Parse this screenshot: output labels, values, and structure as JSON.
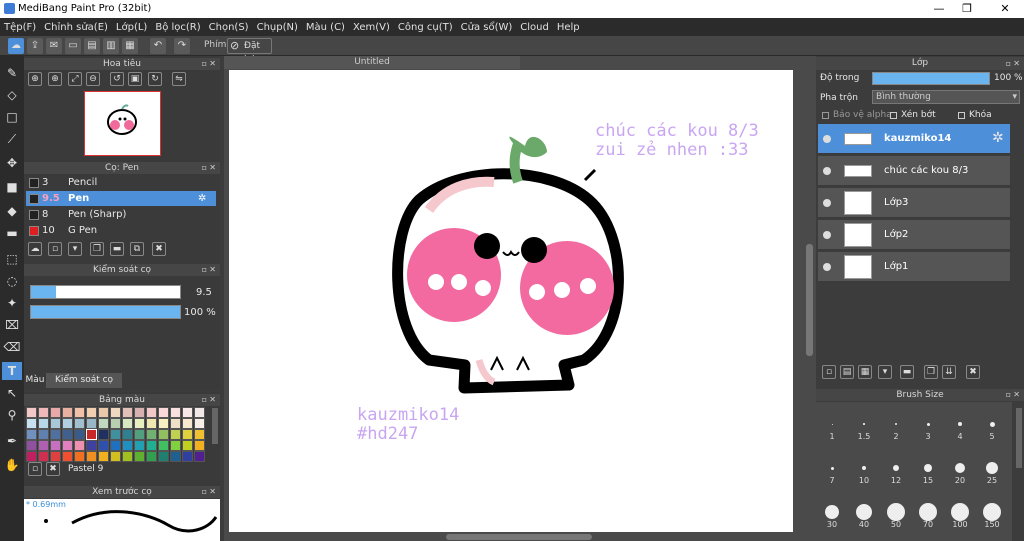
{
  "window": {
    "title": "MediBang Paint Pro (32bit)"
  },
  "menu": [
    "Tệp(F)",
    "Chỉnh sửa(E)",
    "Lớp(L)",
    "Bộ lọc(R)",
    "Chọn(S)",
    "Chụp(N)",
    "Màu (C)",
    "Xem(V)",
    "Công cụ(T)",
    "Cửa sổ(W)",
    "Cloud",
    "Help"
  ],
  "toolbar": {
    "shortcut_label": "Phím",
    "reset_label": "Đặt lại"
  },
  "navigator": {
    "title": "Hoa tiêu"
  },
  "brush_panel": {
    "title": "Cọ: Pen",
    "items": [
      {
        "size": "3",
        "name": "Pencil",
        "color": "#222222"
      },
      {
        "size": "9.5",
        "name": "Pen",
        "color": "#222222"
      },
      {
        "size": "8",
        "name": "Pen (Sharp)",
        "color": "#222222"
      },
      {
        "size": "10",
        "name": "G Pen",
        "color": "#e02020"
      }
    ]
  },
  "brush_control": {
    "title": "Kiểm soát cọ",
    "size_value": "9.5",
    "opacity_value": "100 %",
    "size_fraction": 0.17,
    "opacity_fraction": 1.0,
    "tabs": [
      "Màu",
      "Kiểm soát cọ"
    ]
  },
  "color_palette": {
    "title": "Bảng màu",
    "name": "Pastel 9"
  },
  "preview": {
    "title": "Xem trước cọ",
    "size": "* 0.69mm"
  },
  "canvas": {
    "tab_title": "Untitled",
    "text1": "chúc các kou 8/3",
    "text2": "zui zẻ nhen :33",
    "sign1": "kauzmiko14",
    "sign2": "#hd247",
    "text_color": "#c9a6f2"
  },
  "layers": {
    "title": "Lớp",
    "opacity_label": "Độ trong",
    "opacity_value": "100 %",
    "blend_label": "Pha trộn",
    "blend_value": "Bình thường",
    "alpha_label": "Bảo vệ alpha",
    "clip_label": "Xén bớt",
    "lock_label": "Khóa",
    "items": [
      {
        "name": "kauzmiko14",
        "selected": true
      },
      {
        "name": "chúc các kou 8/3",
        "selected": false
      },
      {
        "name": "Lớp3",
        "selected": false
      },
      {
        "name": "Lớp2",
        "selected": false
      },
      {
        "name": "Lớp1",
        "selected": false
      }
    ]
  },
  "brush_size": {
    "title": "Brush Size",
    "sizes": [
      "1",
      "1.5",
      "2",
      "3",
      "4",
      "5",
      "7",
      "10",
      "12",
      "15",
      "20",
      "25",
      "30",
      "40",
      "50",
      "70",
      "100",
      "150"
    ]
  }
}
